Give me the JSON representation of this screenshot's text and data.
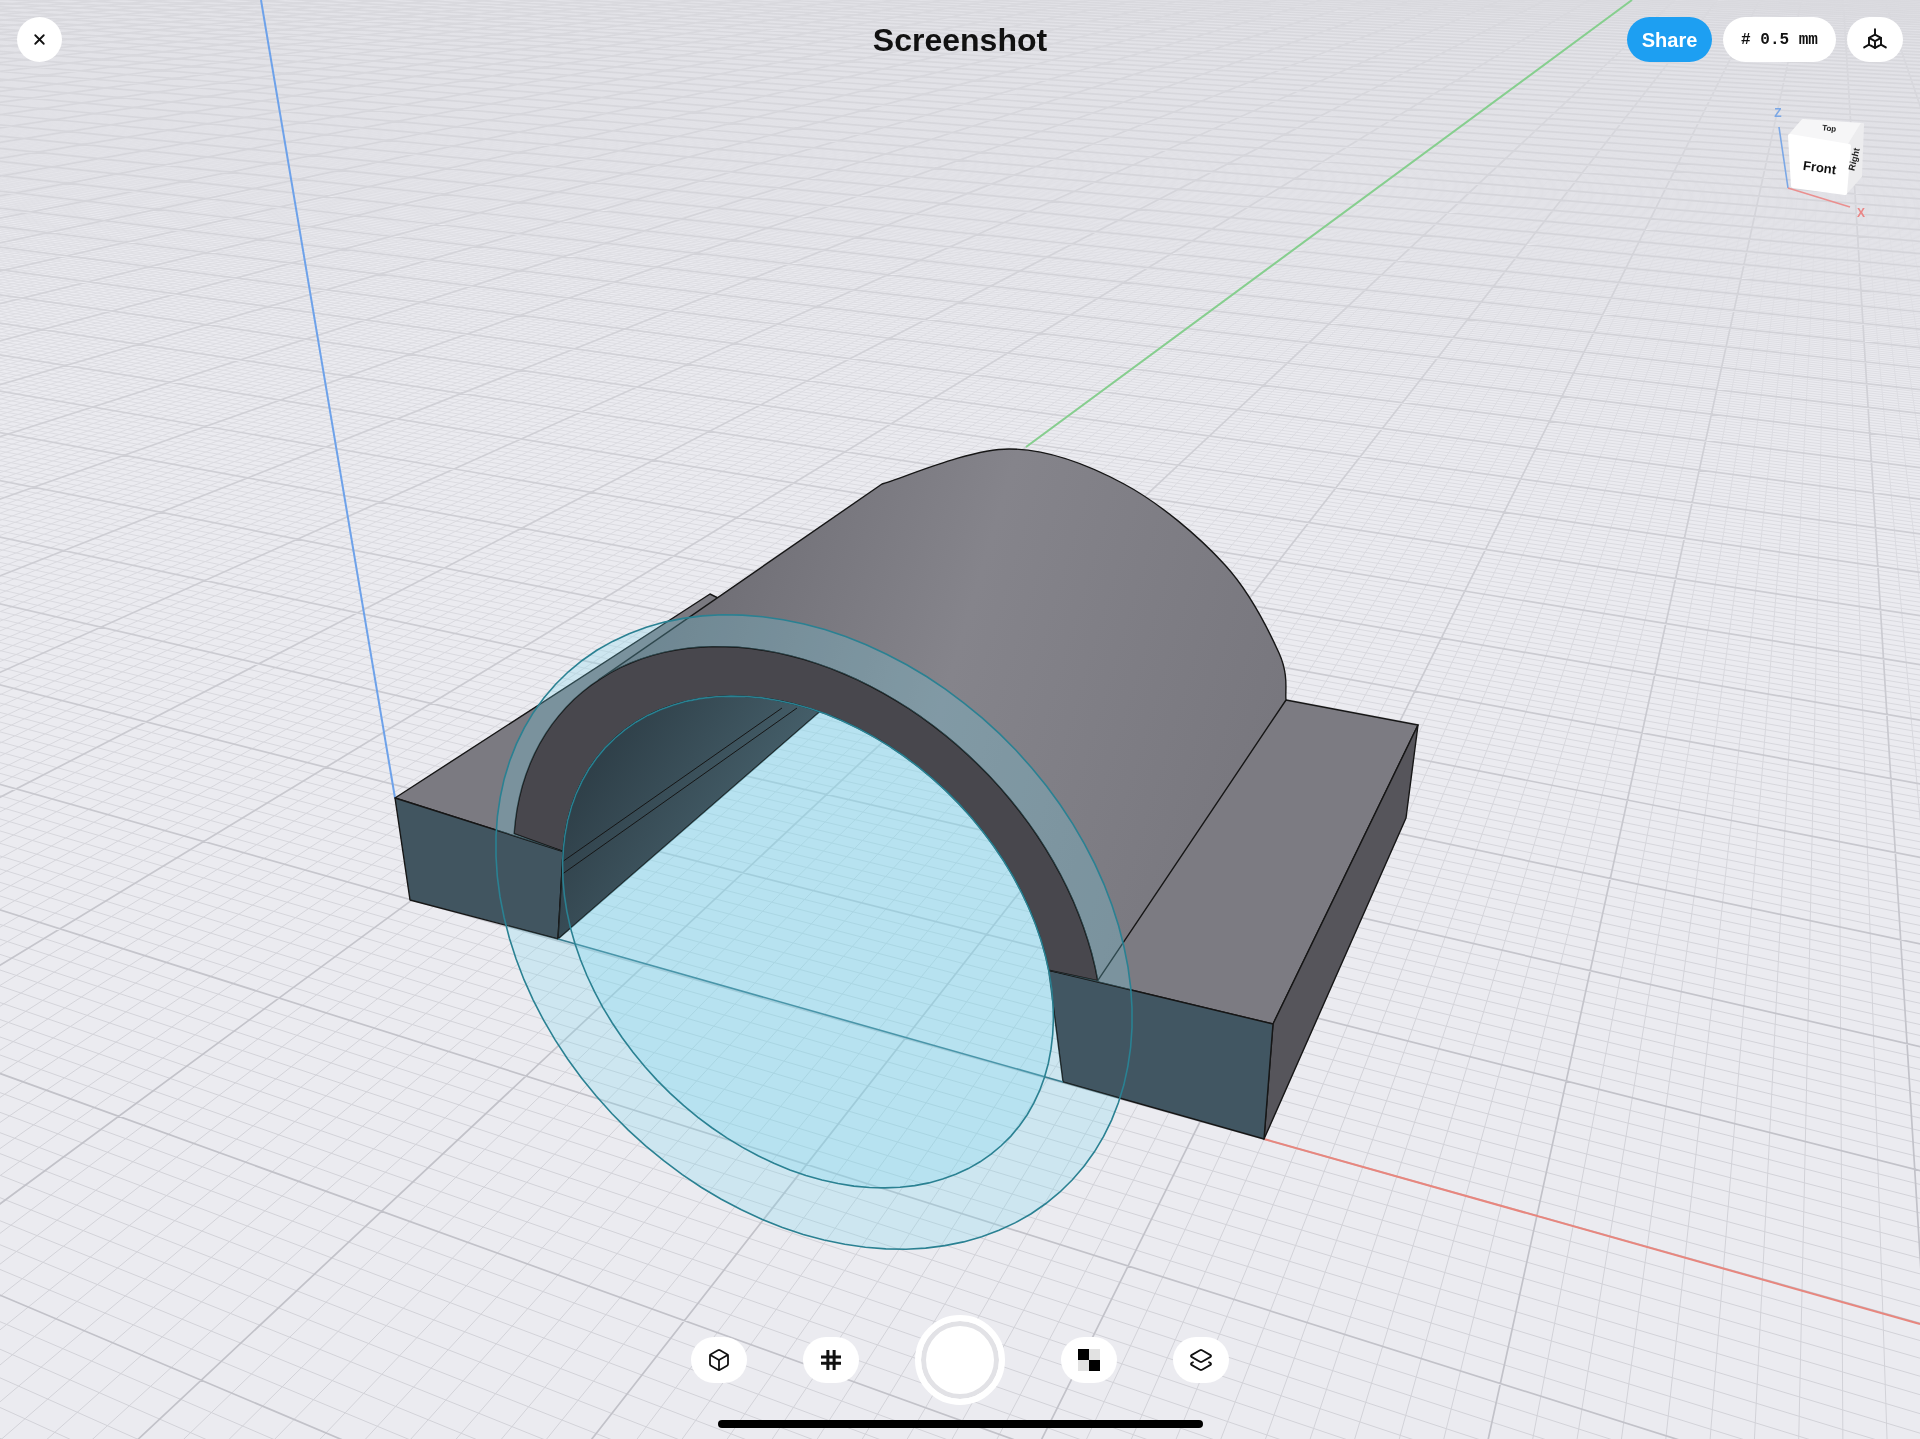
{
  "header": {
    "title": "Screenshot",
    "share_label": "Share",
    "grid_size": "# 0.5 mm"
  },
  "view_cube": {
    "top_face": "Top",
    "front_face": "Front",
    "right_face": "Right",
    "z_axis": "Z",
    "x_axis": "X"
  }
}
